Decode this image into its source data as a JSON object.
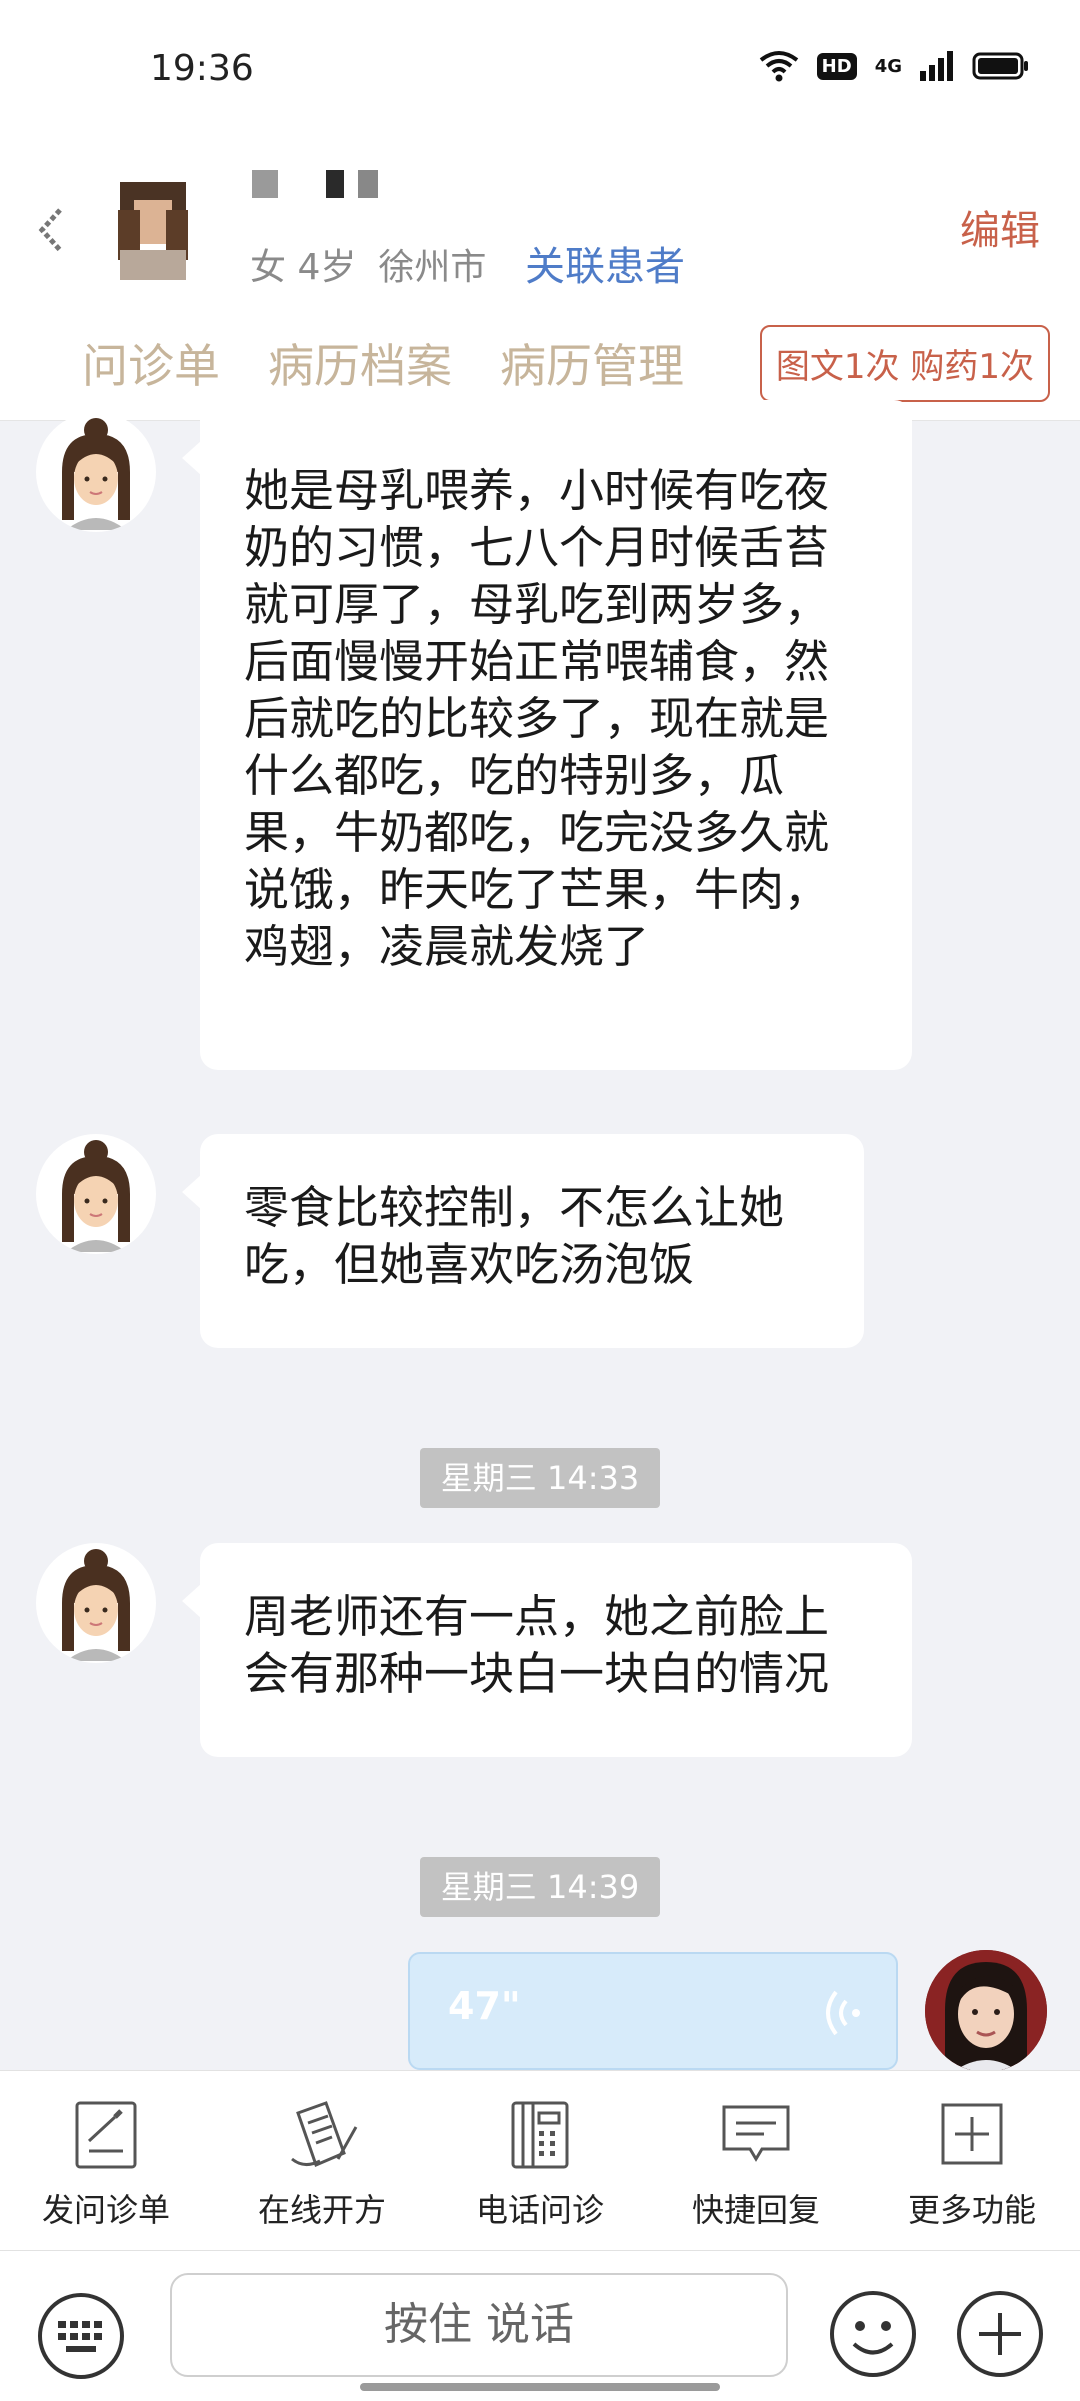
{
  "status_bar": {
    "time": "19:36",
    "hd": "HD",
    "net": "4G"
  },
  "patient": {
    "gender_age": "女 4岁",
    "city": "徐州市",
    "link_label": "关联患者",
    "edit_label": "编辑"
  },
  "tabs": [
    {
      "label": "问诊单"
    },
    {
      "label": "病历档案"
    },
    {
      "label": "病历管理"
    }
  ],
  "service_badge": "图文1次 购药1次",
  "messages": [
    {
      "text": "她是母乳喂养，小时候有吃夜奶的习惯，七八个月时候舌苔就可厚了，母乳吃到两岁多，后面慢慢开始正常喂辅食，然后就吃的比较多了，现在就是什么都吃，吃的特别多，瓜果，牛奶都吃，吃完没多久就说饿，昨天吃了芒果，牛肉，鸡翅，凌晨就发烧了"
    },
    {
      "text": "零食比较控制，不怎么让她吃，但她喜欢吃汤泡饭"
    },
    {
      "timestamp": "星期三 14:33"
    },
    {
      "text": "周老师还有一点，她之前脸上会有那种一块白一块白的情况"
    },
    {
      "timestamp": "星期三 14:39"
    }
  ],
  "voice_message": {
    "duration": "47\""
  },
  "toolbar": [
    {
      "label": "发问诊单",
      "icon": "form-icon"
    },
    {
      "label": "在线开方",
      "icon": "prescription-icon"
    },
    {
      "label": "电话问诊",
      "icon": "phone-icon"
    },
    {
      "label": "快捷回复",
      "icon": "quick-reply-icon"
    },
    {
      "label": "更多功能",
      "icon": "more-icon"
    }
  ],
  "input": {
    "hold_to_talk": "按住 说话"
  }
}
